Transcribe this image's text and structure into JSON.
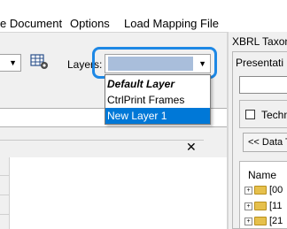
{
  "menu": {
    "document_label": "e Document",
    "options_label": "Options",
    "load_mapping_label": "Load Mapping File"
  },
  "toolbar": {
    "layers_label": "Layers:",
    "table_settings_icon": "table-gear-icon"
  },
  "layers_dropdown": {
    "selected_value": "",
    "items": [
      {
        "label": "Default Layer",
        "style": "bold-italic"
      },
      {
        "label": "CtrlPrint Frames",
        "style": "normal"
      },
      {
        "label": "New Layer 1",
        "style": "selected"
      }
    ]
  },
  "panel": {
    "close_glyph": "✕"
  },
  "right_pane": {
    "title": "XBRL Taxonc",
    "tab_label": "Presentati",
    "tech_label": "Techn",
    "data_button_label": "<< Data T",
    "name_header": "Name",
    "tree_items": [
      "[00",
      "[11",
      "[21"
    ]
  },
  "colors": {
    "highlight": "#1e88e5",
    "selection": "#0078d7",
    "combo_fill": "#a9bedb"
  }
}
